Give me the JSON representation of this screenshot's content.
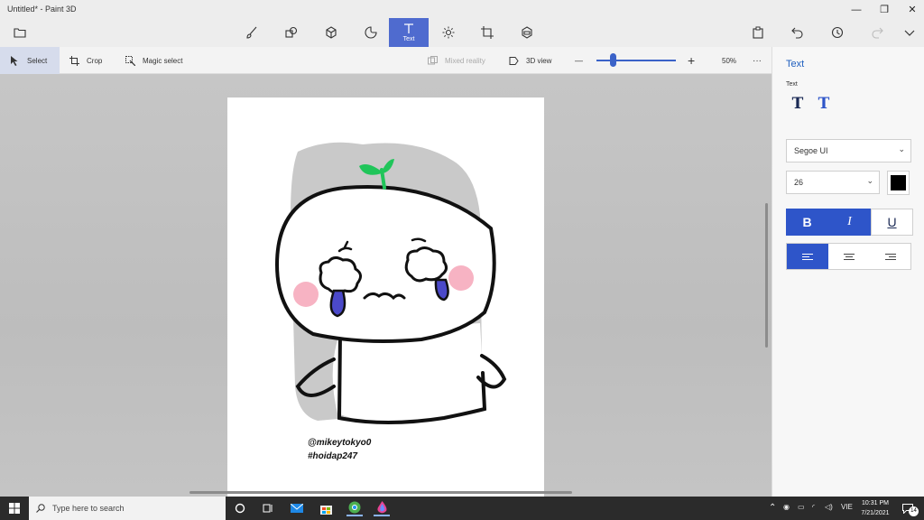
{
  "window": {
    "title": "Untitled* - Paint 3D",
    "minimize": "—",
    "restore": "❐",
    "close": "✕"
  },
  "toolbar": {
    "active_tool_label": "Text"
  },
  "subbar": {
    "select_label": "Select",
    "crop_label": "Crop",
    "magic_select_label": "Magic select",
    "mixed_reality_label": "Mixed reality",
    "view3d_label": "3D view",
    "zoom_minus": "—",
    "zoom_plus": "+",
    "zoom_level": "50%",
    "more": "···"
  },
  "zoom_fraction": 0.2,
  "canvas": {
    "credit_line1": "@mikeytokyo0",
    "credit_line2": "#hoidap247"
  },
  "panel": {
    "title": "Text",
    "section_label": "Text",
    "font_family": "Segoe UI",
    "font_size": "26",
    "text_color": "#000000",
    "bold_label": "B",
    "italic_label": "I",
    "underline_label": "U"
  },
  "taskbar": {
    "search_placeholder": "Type here to search",
    "language": "VIE",
    "time": "10:31 PM",
    "date": "7/21/2021",
    "notification_count": "14"
  },
  "colors": {
    "accent": "#2e55c9",
    "title_link": "#1f5fbf",
    "hair_gray": "#c9c9c9",
    "tear_blue": "#4b49c9",
    "blush_pink": "#f7b3c3",
    "sprout_green": "#20c55a"
  }
}
